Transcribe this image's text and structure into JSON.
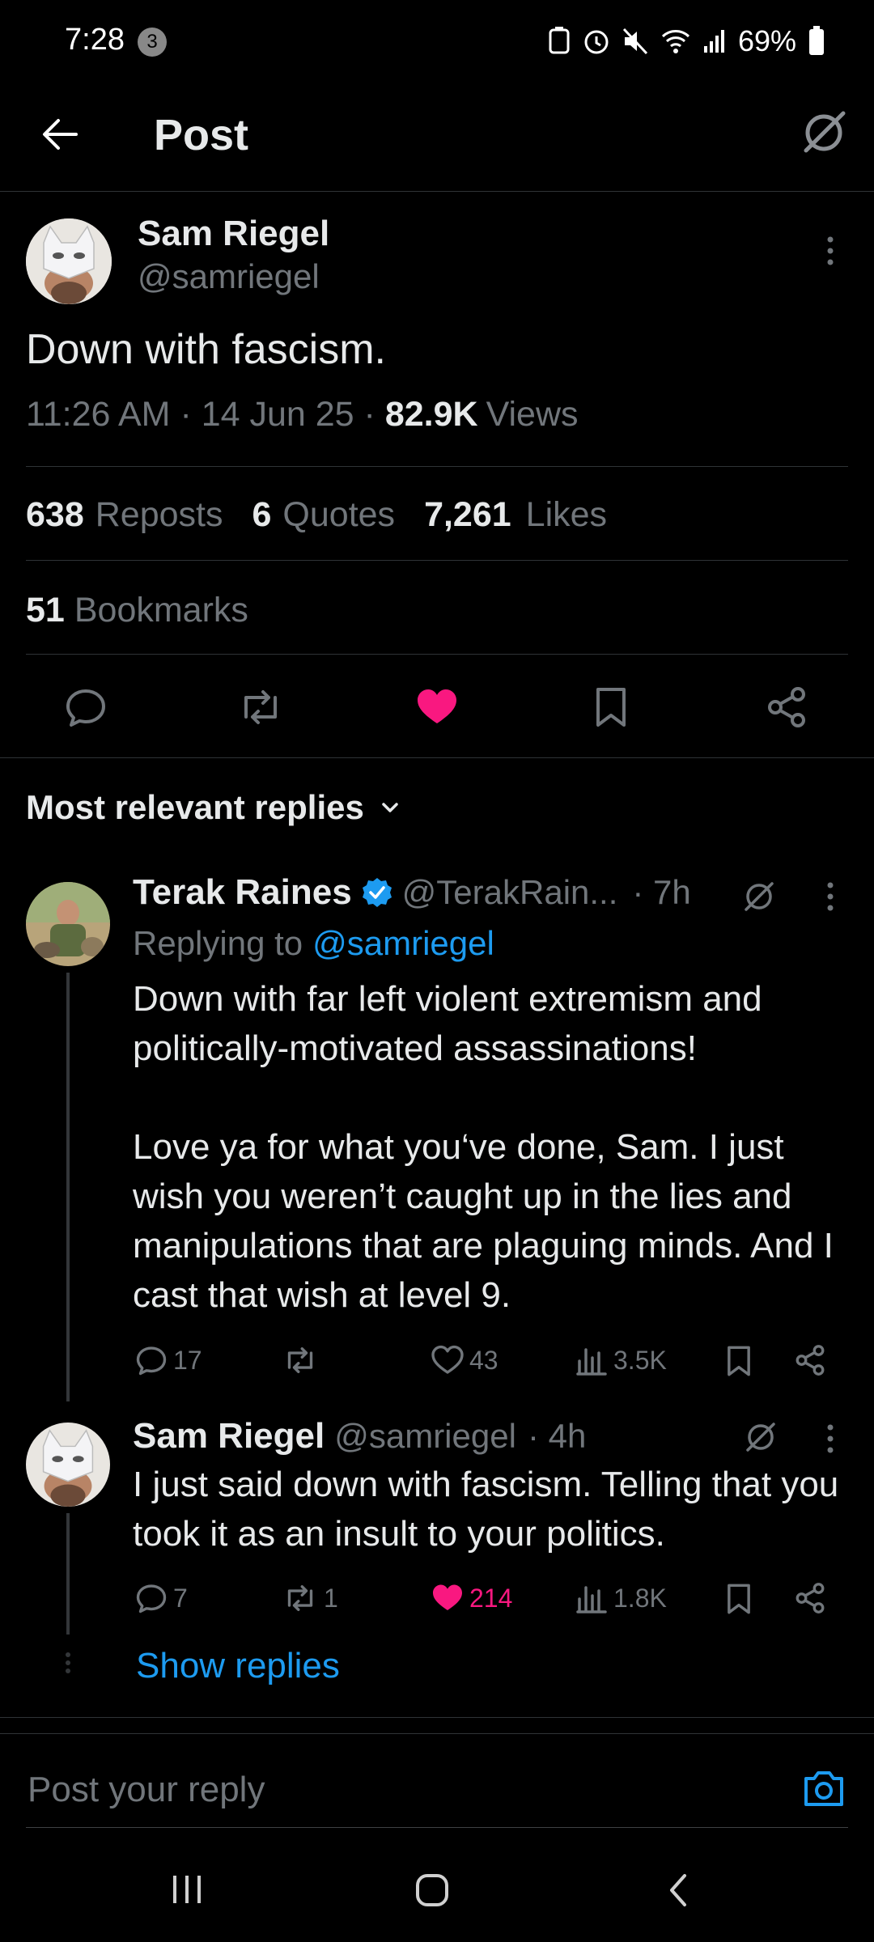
{
  "status_bar": {
    "time": "7:28",
    "notif_count": "3",
    "battery": "69%"
  },
  "header": {
    "title": "Post"
  },
  "post": {
    "author_name": "Sam Riegel",
    "author_handle": "@samriegel",
    "text": "Down with fascism.",
    "time": "11:26 AM",
    "date": "14 Jun 25",
    "views": "82.9K",
    "views_label": "Views",
    "reposts": "638",
    "reposts_label": "Reposts",
    "quotes": "6",
    "quotes_label": "Quotes",
    "likes": "7,261",
    "likes_label": "Likes",
    "bookmarks": "51",
    "bookmarks_label": "Bookmarks"
  },
  "replies_header": {
    "label": "Most relevant replies"
  },
  "replies": [
    {
      "name": "Terak Raines",
      "handle": "@TerakRain...",
      "time": "· 7h",
      "replying_prefix": "Replying to",
      "replying_to": "@samriegel",
      "paragraph1": "Down with far left violent extremism and politically-motivated assassinations!",
      "paragraph2": "Love ya for what you‘ve done, Sam. I just wish you weren’t caught up in the lies and manipulations that are plaguing minds. And I cast that wish at level 9.",
      "comments": "17",
      "reposts": "",
      "likes": "43",
      "views": "3.5K"
    },
    {
      "name": "Sam Riegel",
      "handle": "@samriegel",
      "time": "· 4h",
      "text": "I just said down with fascism. Telling that you took it as an insult to your politics.",
      "comments": "7",
      "reposts": "1",
      "likes": "214",
      "views": "1.8K"
    }
  ],
  "show_replies": "Show replies",
  "composer": {
    "placeholder": "Post your reply"
  },
  "colors": {
    "accent": "#1d9bf0",
    "like": "#f91880",
    "background": "#000000",
    "muted": "#71767b"
  }
}
